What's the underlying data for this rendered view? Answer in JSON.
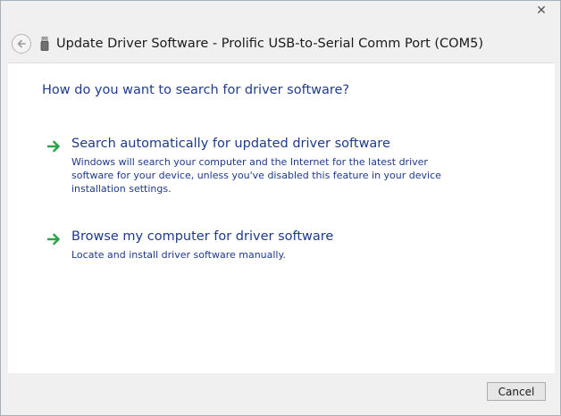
{
  "window": {
    "title": "Update Driver Software - Prolific USB-to-Serial Comm Port (COM5)",
    "close_label": "✕"
  },
  "header": {
    "back_icon": "back-arrow-icon",
    "device_icon": "usb-device-icon"
  },
  "main": {
    "question": "How do you want to search for driver software?",
    "options": [
      {
        "title": "Search automatically for updated driver software",
        "description": "Windows will search your computer and the Internet for the latest driver software for your device, unless you've disabled this feature in your device installation settings.",
        "icon": "green-arrow-icon"
      },
      {
        "title": "Browse my computer for driver software",
        "description": "Locate and install driver software manually.",
        "icon": "green-arrow-icon"
      }
    ]
  },
  "footer": {
    "cancel_label": "Cancel"
  },
  "colors": {
    "link_blue": "#1e3a8a",
    "arrow_green": "#2da44a",
    "content_bg": "#ffffff",
    "chrome_bg": "#f0f0f0"
  }
}
